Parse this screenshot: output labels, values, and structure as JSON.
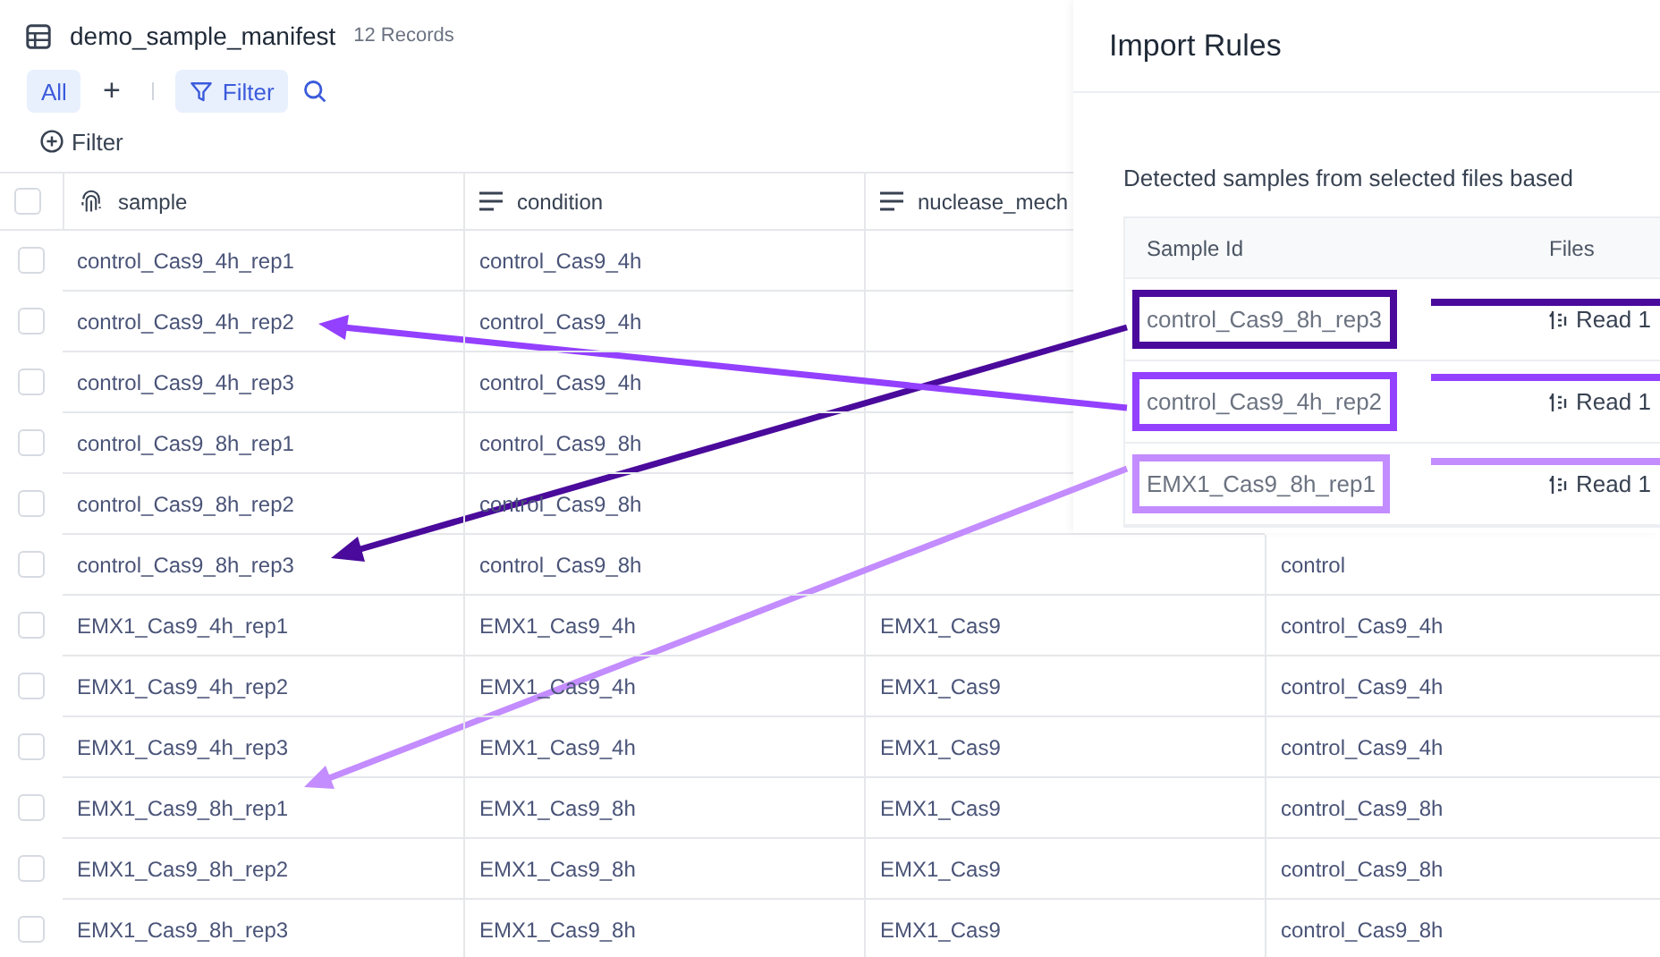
{
  "header": {
    "title": "demo_sample_manifest",
    "count": "12 Records"
  },
  "toolbar": {
    "views": [
      {
        "label": "All",
        "selected": true
      }
    ],
    "add": "+",
    "filter": "Filter",
    "add_filter": "Filter"
  },
  "table": {
    "select_all": {
      "checked": false
    },
    "columns": [
      {
        "label": "sample",
        "kind": "id"
      },
      {
        "label": "condition",
        "kind": "text"
      },
      {
        "label": "nuclease_mech",
        "kind": "text"
      }
    ],
    "rows": [
      {
        "checked": false,
        "cells": [
          "control_Cas9_4h_rep1",
          "control_Cas9_4h"
        ]
      },
      {
        "checked": false,
        "cells": [
          "control_Cas9_4h_rep2",
          "control_Cas9_4h"
        ]
      },
      {
        "checked": false,
        "cells": [
          "control_Cas9_4h_rep3",
          "control_Cas9_4h"
        ]
      },
      {
        "checked": false,
        "cells": [
          "control_Cas9_8h_rep1",
          "control_Cas9_8h"
        ]
      },
      {
        "checked": false,
        "cells": [
          "control_Cas9_8h_rep2",
          "control_Cas9_8h"
        ]
      },
      {
        "checked": false,
        "cells": [
          "control_Cas9_8h_rep3",
          "control_Cas9_8h",
          "",
          "control"
        ]
      },
      {
        "checked": false,
        "cells": [
          "EMX1_Cas9_4h_rep1",
          "EMX1_Cas9_4h",
          "EMX1_Cas9",
          "control_Cas9_4h"
        ]
      },
      {
        "checked": false,
        "cells": [
          "EMX1_Cas9_4h_rep2",
          "EMX1_Cas9_4h",
          "EMX1_Cas9",
          "control_Cas9_4h"
        ]
      },
      {
        "checked": false,
        "cells": [
          "EMX1_Cas9_4h_rep3",
          "EMX1_Cas9_4h",
          "EMX1_Cas9",
          "control_Cas9_4h"
        ]
      },
      {
        "checked": false,
        "cells": [
          "EMX1_Cas9_8h_rep1",
          "EMX1_Cas9_8h",
          "EMX1_Cas9",
          "control_Cas9_8h"
        ]
      },
      {
        "checked": false,
        "cells": [
          "EMX1_Cas9_8h_rep2",
          "EMX1_Cas9_8h",
          "EMX1_Cas9",
          "control_Cas9_8h"
        ]
      },
      {
        "checked": false,
        "cells": [
          "EMX1_Cas9_8h_rep3",
          "EMX1_Cas9_8h",
          "EMX1_Cas9",
          "control_Cas9_8h"
        ]
      }
    ]
  },
  "panel": {
    "title": "Import Rules",
    "description": "Detected samples from selected files based",
    "columns": [
      "Sample Id",
      "Files"
    ],
    "rows": [
      {
        "sample_id": "control_Cas9_8h_rep3",
        "file": "Read 1",
        "color": "#4a0a9b"
      },
      {
        "sample_id": "control_Cas9_4h_rep2",
        "file": "Read 1",
        "color": "#9340ff"
      },
      {
        "sample_id": "EMX1_Cas9_8h_rep1",
        "file": "Read 1",
        "color": "#c38cff"
      }
    ]
  }
}
